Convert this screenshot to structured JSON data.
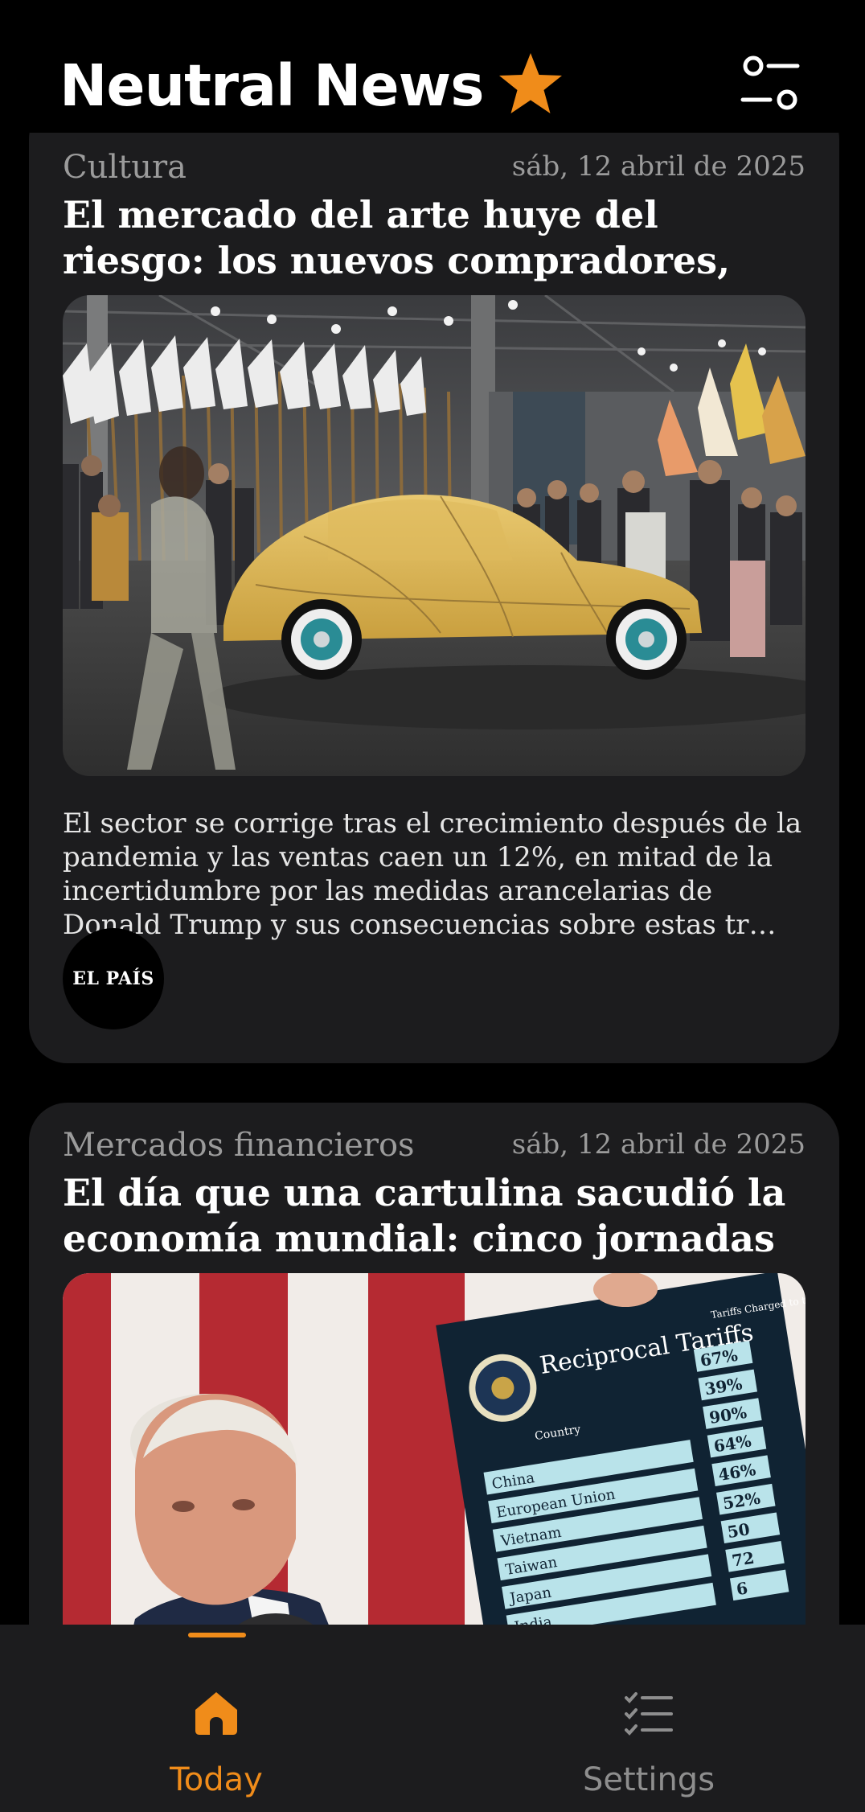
{
  "header": {
    "title": "Neutral News",
    "favorites_icon": "star-icon",
    "filter_icon": "filter-sliders-icon"
  },
  "colors": {
    "accent": "#f08c1a",
    "card_background": "#1c1c1e",
    "page_background": "#000000",
    "muted_text": "#9b9b9b"
  },
  "feed": {
    "articles": [
      {
        "category": "Cultura",
        "date": "sáb, 12 abril de 2025",
        "headline": "El mercado del arte huye del riesgo: los nuevos compradores, que gastan",
        "summary": "El sector se corrige tras el crecimiento después de la pandemia y las ventas caen un 12%, en mitad de la incertidumbre por las medidas arancelarias de Donald Trump y sus consecuencias sobre estas tr…",
        "source": "EL PAÍS"
      },
      {
        "category": "Mercados financieros",
        "date": "sáb, 12 abril de 2025",
        "headline": "El día que una cartulina sacudió la economía mundial: cinco jornadas de",
        "image_text": {
          "board_title": "Reciprocal Tariffs",
          "column_header": "Country",
          "charged_header": "Tariffs Charged to the U.S.A.",
          "countries": [
            "China",
            "European Union",
            "Vietnam",
            "Taiwan",
            "Japan",
            "India"
          ],
          "values": [
            "67%",
            "39%",
            "90%",
            "64%",
            "46%",
            "52%",
            "50",
            "72",
            "6"
          ]
        }
      }
    ]
  },
  "bottom_nav": {
    "items": [
      {
        "label": "Today",
        "icon": "home-icon",
        "active": true
      },
      {
        "label": "Settings",
        "icon": "checklist-icon",
        "active": false
      }
    ]
  }
}
